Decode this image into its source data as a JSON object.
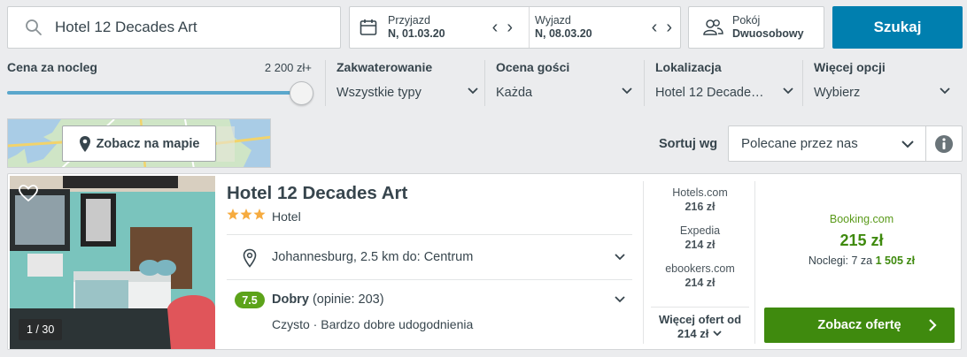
{
  "search": {
    "value": "Hotel 12 Decades Art"
  },
  "dates": {
    "checkin_label": "Przyjazd",
    "checkin_value": "N, 01.03.20",
    "checkout_label": "Wyjazd",
    "checkout_value": "N, 08.03.20"
  },
  "room": {
    "label": "Pokój",
    "value": "Dwuosobowy"
  },
  "search_button": "Szukaj",
  "filters": {
    "price": {
      "label": "Cena za nocleg",
      "max": "2 200 zł+"
    },
    "accommodation": {
      "label": "Zakwaterowanie",
      "value": "Wszystkie typy"
    },
    "guest_rating": {
      "label": "Ocena gości",
      "value": "Każda"
    },
    "location": {
      "label": "Lokalizacja",
      "value": "Hotel 12 Decade…"
    },
    "more": {
      "label": "Więcej opcji",
      "value": "Wybierz"
    }
  },
  "map_button": "Zobacz na mapie",
  "sort": {
    "label": "Sortuj wg",
    "value": "Polecane przez nas"
  },
  "hotel": {
    "name": "Hotel 12 Decades Art",
    "stars": 3,
    "type": "Hotel",
    "location": "Johannesburg, 2.5 km do: Centrum",
    "rating_score": "7.5",
    "rating_word": "Dobry",
    "rating_count": "(opinie: 203)",
    "features": "Czysto · Bardzo dobre udogodnienia",
    "photo_counter": "1 / 30"
  },
  "offers": [
    {
      "provider": "Hotels.com",
      "price": "216 zł"
    },
    {
      "provider": "Expedia",
      "price": "214 zł"
    },
    {
      "provider": "ebookers.com",
      "price": "214 zł"
    }
  ],
  "more_offers": {
    "label": "Więcej ofert od",
    "price": "214 zł"
  },
  "best_deal": {
    "provider": "Booking.com",
    "price": "215 zł",
    "nights_text": "Noclegi: 7 za",
    "nights_total": "1 505 zł",
    "button": "Zobacz ofertę"
  },
  "colors": {
    "accent": "#007faf",
    "deal_green": "#3f8a0e",
    "rating_green": "#5ca31a",
    "star": "#f6ab3f"
  }
}
